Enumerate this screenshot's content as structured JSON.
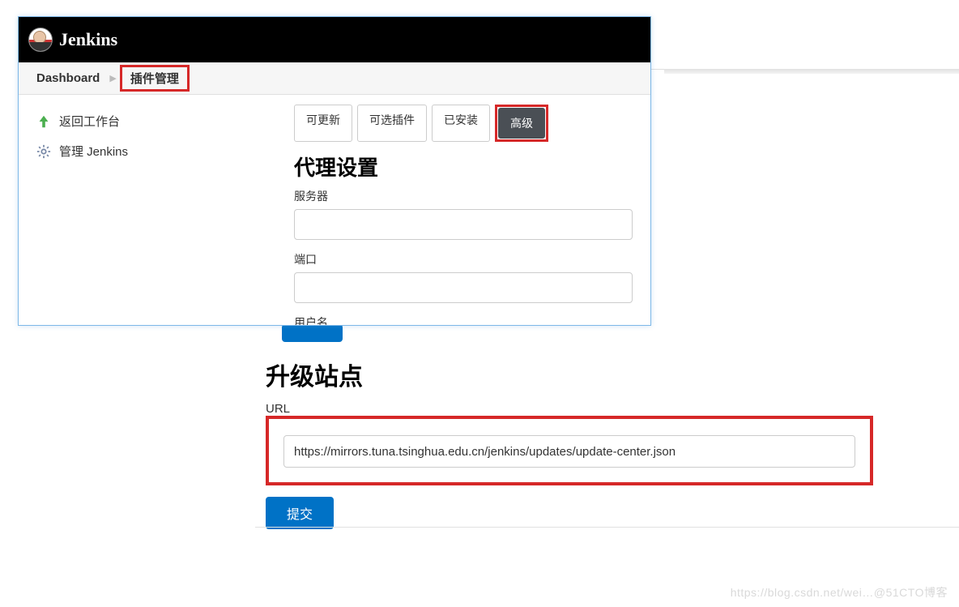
{
  "header": {
    "app_title": "Jenkins"
  },
  "breadcrumb": {
    "dashboard": "Dashboard",
    "plugin_manager": "插件管理"
  },
  "sidebar": {
    "items": [
      {
        "label": "返回工作台"
      },
      {
        "label": "管理 Jenkins"
      }
    ]
  },
  "tabs": {
    "updatable": "可更新",
    "available": "可选插件",
    "installed": "已安装",
    "advanced": "高级"
  },
  "proxy": {
    "section_title": "代理设置",
    "server_label": "服务器",
    "port_label": "端口",
    "username_label": "用户名"
  },
  "upgrade": {
    "section_title": "升级站点",
    "url_label": "URL",
    "url_value": "https://mirrors.tuna.tsinghua.edu.cn/jenkins/updates/update-center.json",
    "submit_label": "提交"
  },
  "watermark": "https://blog.csdn.net/wei…@51CTO博客"
}
